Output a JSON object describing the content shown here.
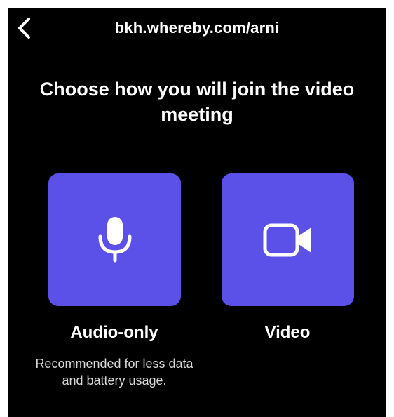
{
  "header": {
    "url": "bkh.whereby.com/arni",
    "back_icon": "chevron-left-icon"
  },
  "heading": "Choose how you will join the video meeting",
  "options": [
    {
      "label": "Audio-only",
      "description": "Recommended for less data and battery usage.",
      "icon": "microphone-icon"
    },
    {
      "label": "Video",
      "description": "",
      "icon": "video-camera-icon"
    }
  ],
  "colors": {
    "background": "#000000",
    "tile": "#5b50e8",
    "text": "#ffffff",
    "muted_text": "#d8d8d8"
  }
}
